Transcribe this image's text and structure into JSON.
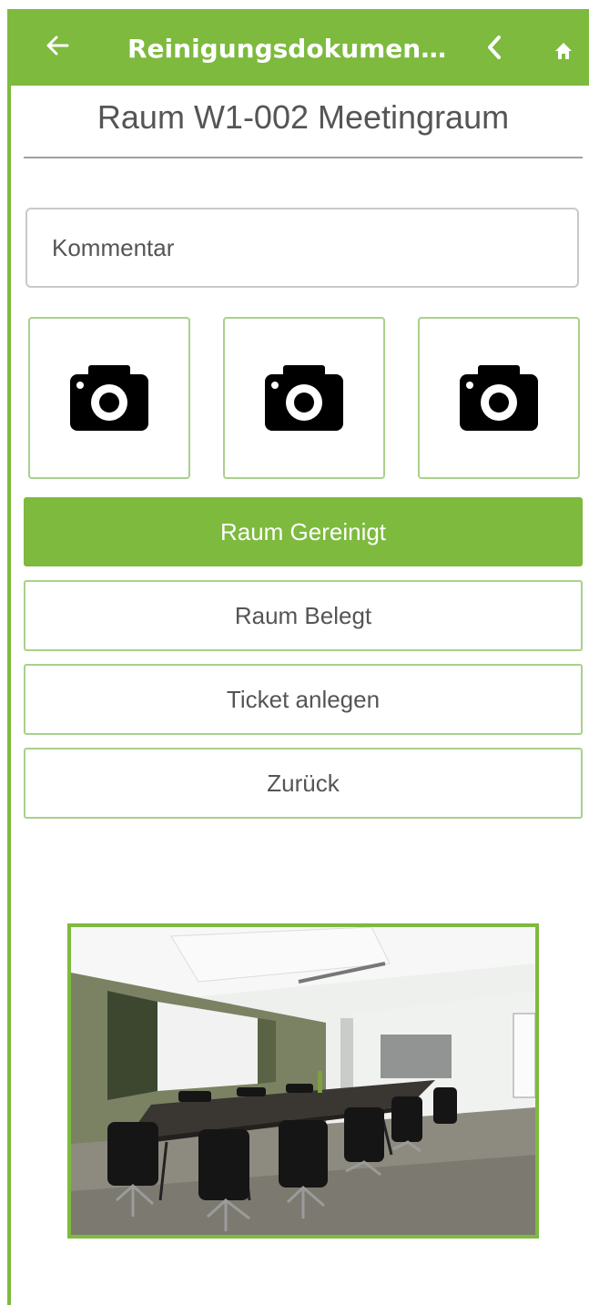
{
  "appbar": {
    "title": "Reinigungsdokumen…",
    "back_icon": "arrow-left-icon",
    "prev_icon": "chevron-left-icon",
    "home_icon": "home-icon"
  },
  "room": {
    "title": "Raum W1-002 Meetingraum"
  },
  "comment": {
    "placeholder": "Kommentar",
    "value": ""
  },
  "photos": {
    "icon": "camera-icon",
    "count": 3
  },
  "actions": {
    "cleaned_label": "Raum Gereinigt",
    "occupied_label": "Raum Belegt",
    "ticket_label": "Ticket anlegen",
    "back_label": "Zurück"
  },
  "colors": {
    "brand_green": "#7dba3e",
    "border_green": "#a9d18a",
    "text_gray": "#555555"
  }
}
